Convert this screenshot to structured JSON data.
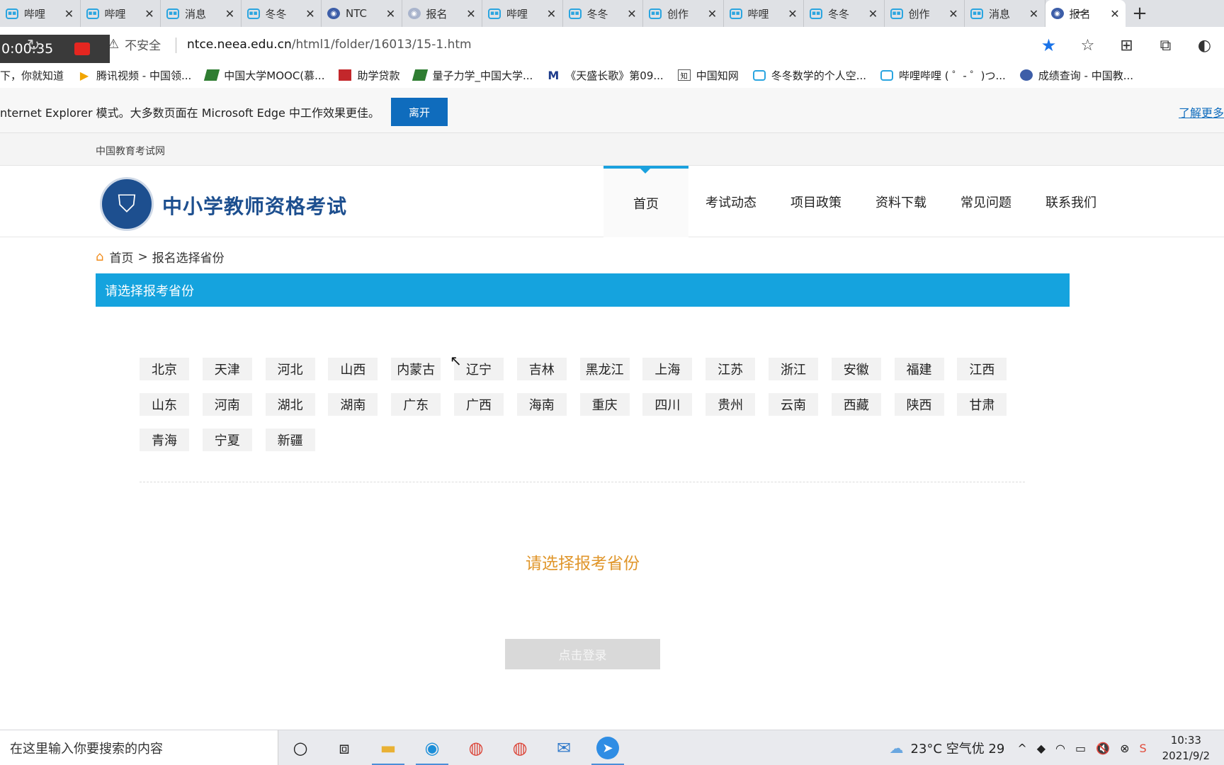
{
  "browser": {
    "tabs": [
      {
        "title": "哔哩",
        "icon": "bilibili-icon",
        "active": false
      },
      {
        "title": "哔哩",
        "icon": "bilibili-icon",
        "active": false
      },
      {
        "title": "消息",
        "icon": "bilibili-icon",
        "active": false
      },
      {
        "title": "冬冬",
        "icon": "bilibili-icon",
        "active": false
      },
      {
        "title": "NTC",
        "icon": "globe-icon",
        "active": false
      },
      {
        "title": "报名",
        "icon": "globe-icon",
        "active": false
      },
      {
        "title": "哔哩",
        "icon": "bilibili-icon",
        "active": false
      },
      {
        "title": "冬冬",
        "icon": "bilibili-icon",
        "active": false
      },
      {
        "title": "创作",
        "icon": "bilibili-icon",
        "active": false
      },
      {
        "title": "哔哩",
        "icon": "bilibili-icon",
        "active": false
      },
      {
        "title": "冬冬",
        "icon": "bilibili-icon",
        "active": false
      },
      {
        "title": "创作",
        "icon": "bilibili-icon",
        "active": false
      },
      {
        "title": "消息",
        "icon": "bilibili-icon",
        "active": false
      },
      {
        "title": "报名",
        "icon": "globe-icon",
        "active": true
      }
    ],
    "new_tab_label": "+",
    "timer": "0:00:35",
    "security_label": "不安全",
    "url_host": "ntce.neea.edu.cn",
    "url_path": "/html1/folder/16013/15-1.htm",
    "bookmarks": [
      {
        "label": "下，你就知道",
        "icon": "none"
      },
      {
        "label": "腾讯视频 - 中国领...",
        "icon": "play-icon"
      },
      {
        "label": "中国大学MOOC(慕...",
        "icon": "mooc-icon"
      },
      {
        "label": "助学贷款",
        "icon": "loan-icon"
      },
      {
        "label": "量子力学_中国大学...",
        "icon": "mooc-icon"
      },
      {
        "label": "《天盛长歌》第09...",
        "icon": "m-icon"
      },
      {
        "label": "中国知网",
        "icon": "cnki-icon"
      },
      {
        "label": "冬冬数学的个人空...",
        "icon": "bilibili-icon"
      },
      {
        "label": "哔哩哔哩 ( ゜- ゜)つ...",
        "icon": "bilibili-icon"
      },
      {
        "label": "成绩查询 - 中国教...",
        "icon": "globe-icon"
      }
    ],
    "ie_mode_text": "nternet Explorer 模式。大多数页面在 Microsoft Edge 中工作效果更佳。",
    "ie_leave_label": "离开",
    "ie_more_label": "了解更多"
  },
  "site": {
    "top_link": "中国教育考试网",
    "logo_title": "中小学教师资格考试",
    "nav": [
      {
        "label": "首页",
        "active": true
      },
      {
        "label": "考试动态",
        "active": false
      },
      {
        "label": "项目政策",
        "active": false
      },
      {
        "label": "资料下载",
        "active": false
      },
      {
        "label": "常见问题",
        "active": false
      },
      {
        "label": "联系我们",
        "active": false
      }
    ],
    "breadcrumb": {
      "home": "首页",
      "separator": ">",
      "current": "报名选择省份"
    },
    "panel_title": "请选择报考省份",
    "provinces": [
      "北京",
      "天津",
      "河北",
      "山西",
      "内蒙古",
      "辽宁",
      "吉林",
      "黑龙江",
      "上海",
      "江苏",
      "浙江",
      "安徽",
      "福建",
      "江西",
      "山东",
      "河南",
      "湖北",
      "湖南",
      "广东",
      "广西",
      "海南",
      "重庆",
      "四川",
      "贵州",
      "云南",
      "西藏",
      "陕西",
      "甘肃",
      "青海",
      "宁夏",
      "新疆"
    ],
    "prompt": "请选择报考省份",
    "login_label": "点击登录",
    "colors": {
      "accent": "#15a3de",
      "prompt": "#e0962b",
      "brand": "#1d4f8f"
    }
  },
  "taskbar": {
    "search_placeholder": "在这里输入你要搜索的内容",
    "weather": "23°C 空气优 29",
    "time": "10:33",
    "date": "2021/9/2"
  }
}
